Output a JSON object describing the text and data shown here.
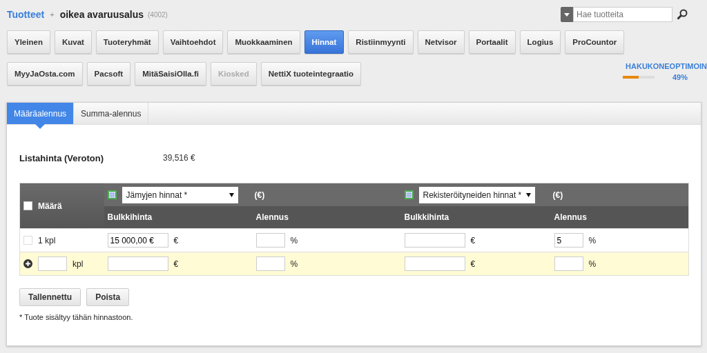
{
  "breadcrumb": {
    "root": "Tuotteet",
    "separator": "+",
    "title": "oikea avaruusalus",
    "code": "(4002)"
  },
  "search": {
    "placeholder": "Hae tuotteita"
  },
  "nav_rows": [
    [
      {
        "label": "Yleinen",
        "selected": false,
        "disabled": false
      },
      {
        "label": "Kuvat",
        "selected": false,
        "disabled": false
      },
      {
        "label": "Tuoteryhmät",
        "selected": false,
        "disabled": false
      },
      {
        "label": "Vaihtoehdot",
        "selected": false,
        "disabled": false
      },
      {
        "label": "Muokkaaminen",
        "selected": false,
        "disabled": false
      },
      {
        "label": "Hinnat",
        "selected": true,
        "disabled": false
      },
      {
        "label": "Ristiinmyynti",
        "selected": false,
        "disabled": false
      },
      {
        "label": "Netvisor",
        "selected": false,
        "disabled": false
      },
      {
        "label": "Portaalit",
        "selected": false,
        "disabled": false
      },
      {
        "label": "Logius",
        "selected": false,
        "disabled": false
      },
      {
        "label": "ProCountor",
        "selected": false,
        "disabled": false
      }
    ],
    [
      {
        "label": "MyyJaOsta.com",
        "selected": false,
        "disabled": false
      },
      {
        "label": "Pacsoft",
        "selected": false,
        "disabled": false
      },
      {
        "label": "MitäSaisiOlla.fi",
        "selected": false,
        "disabled": false
      },
      {
        "label": "Kiosked",
        "selected": false,
        "disabled": true
      },
      {
        "label": "NettiX tuoteintegraatio",
        "selected": false,
        "disabled": false
      }
    ]
  ],
  "seo": {
    "label": "HAKUKONEOPTIMOIN",
    "level": 0.49,
    "reading": "49%"
  },
  "tabs": [
    {
      "label": "Määräalennus",
      "selected": true
    },
    {
      "label": "Summa-alennus",
      "selected": false
    }
  ],
  "list_price": {
    "label": "Listahinta (Veroton)",
    "value": "39,516 €"
  },
  "table": {
    "quantity_header": "Määrä",
    "all_checked": false,
    "price_groups": [
      {
        "select": "Jämyjen hinnat *",
        "currency": "(€)",
        "price_header": "Bulkkihinta",
        "discount_header": "Alennus"
      },
      {
        "select": "Rekisteröityneiden hinnat *",
        "currency": "(€)",
        "price_header": "Bulkkihinta",
        "discount_header": "Alennus"
      }
    ],
    "rows": [
      {
        "checked": false,
        "quantity": "1 kpl",
        "cells": [
          {
            "price": "15 000,00 €",
            "price_unit": "€",
            "discount_unit": "%"
          },
          {
            "price_unit": "€",
            "discount": "5",
            "discount_unit": "%"
          }
        ]
      }
    ],
    "new_row": {
      "quantity_unit": "kpl",
      "cells": [
        {
          "price_unit": "€",
          "discount_unit": "%"
        },
        {
          "price_unit": "€",
          "discount_unit": "%"
        }
      ]
    }
  },
  "buttons": [
    "Tallennettu",
    "Poista"
  ],
  "footnote": "* Tuote sisältyy tähän hinnastoon."
}
